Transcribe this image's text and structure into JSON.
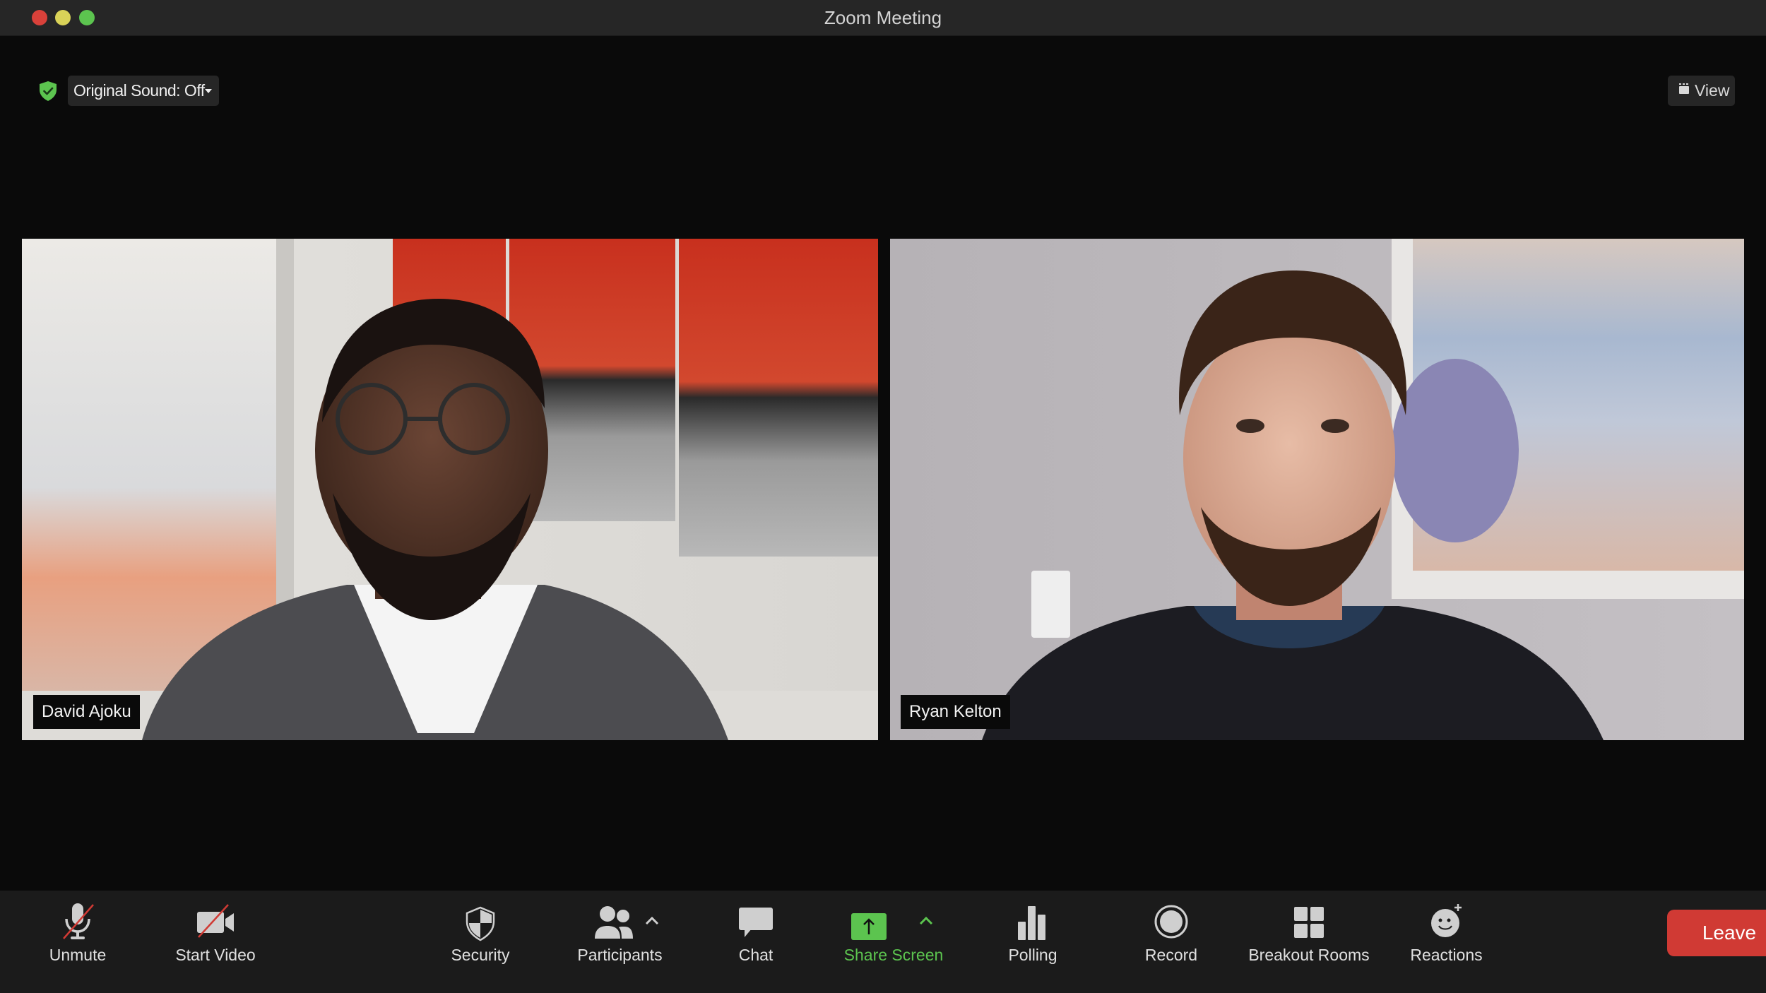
{
  "window": {
    "title": "Zoom Meeting",
    "traffic_lights": [
      "close",
      "minimize",
      "zoom"
    ]
  },
  "top_bar": {
    "security_badge_icon": "shield-check-icon",
    "security_badge_color": "#5cc44f",
    "original_sound_label": "Original Sound: Off",
    "view_label": "View"
  },
  "participants": [
    {
      "name": "David Ajoku"
    },
    {
      "name": "Ryan Kelton"
    }
  ],
  "toolbar": {
    "unmute": {
      "label": "Unmute",
      "icon": "microphone-muted-icon"
    },
    "start_video": {
      "label": "Start Video",
      "icon": "video-off-icon"
    },
    "security": {
      "label": "Security",
      "icon": "shield-icon"
    },
    "participants": {
      "label": "Participants",
      "icon": "participants-icon"
    },
    "chat": {
      "label": "Chat",
      "icon": "chat-bubble-icon"
    },
    "share_screen": {
      "label": "Share Screen",
      "icon": "share-screen-icon",
      "color": "#5cc44f"
    },
    "polling": {
      "label": "Polling",
      "icon": "bar-chart-icon"
    },
    "record": {
      "label": "Record",
      "icon": "record-icon"
    },
    "breakout_rooms": {
      "label": "Breakout Rooms",
      "icon": "grid-icon"
    },
    "reactions": {
      "label": "Reactions",
      "icon": "smiley-plus-icon"
    },
    "leave": {
      "label": "Leave",
      "color": "#d03a34"
    }
  }
}
